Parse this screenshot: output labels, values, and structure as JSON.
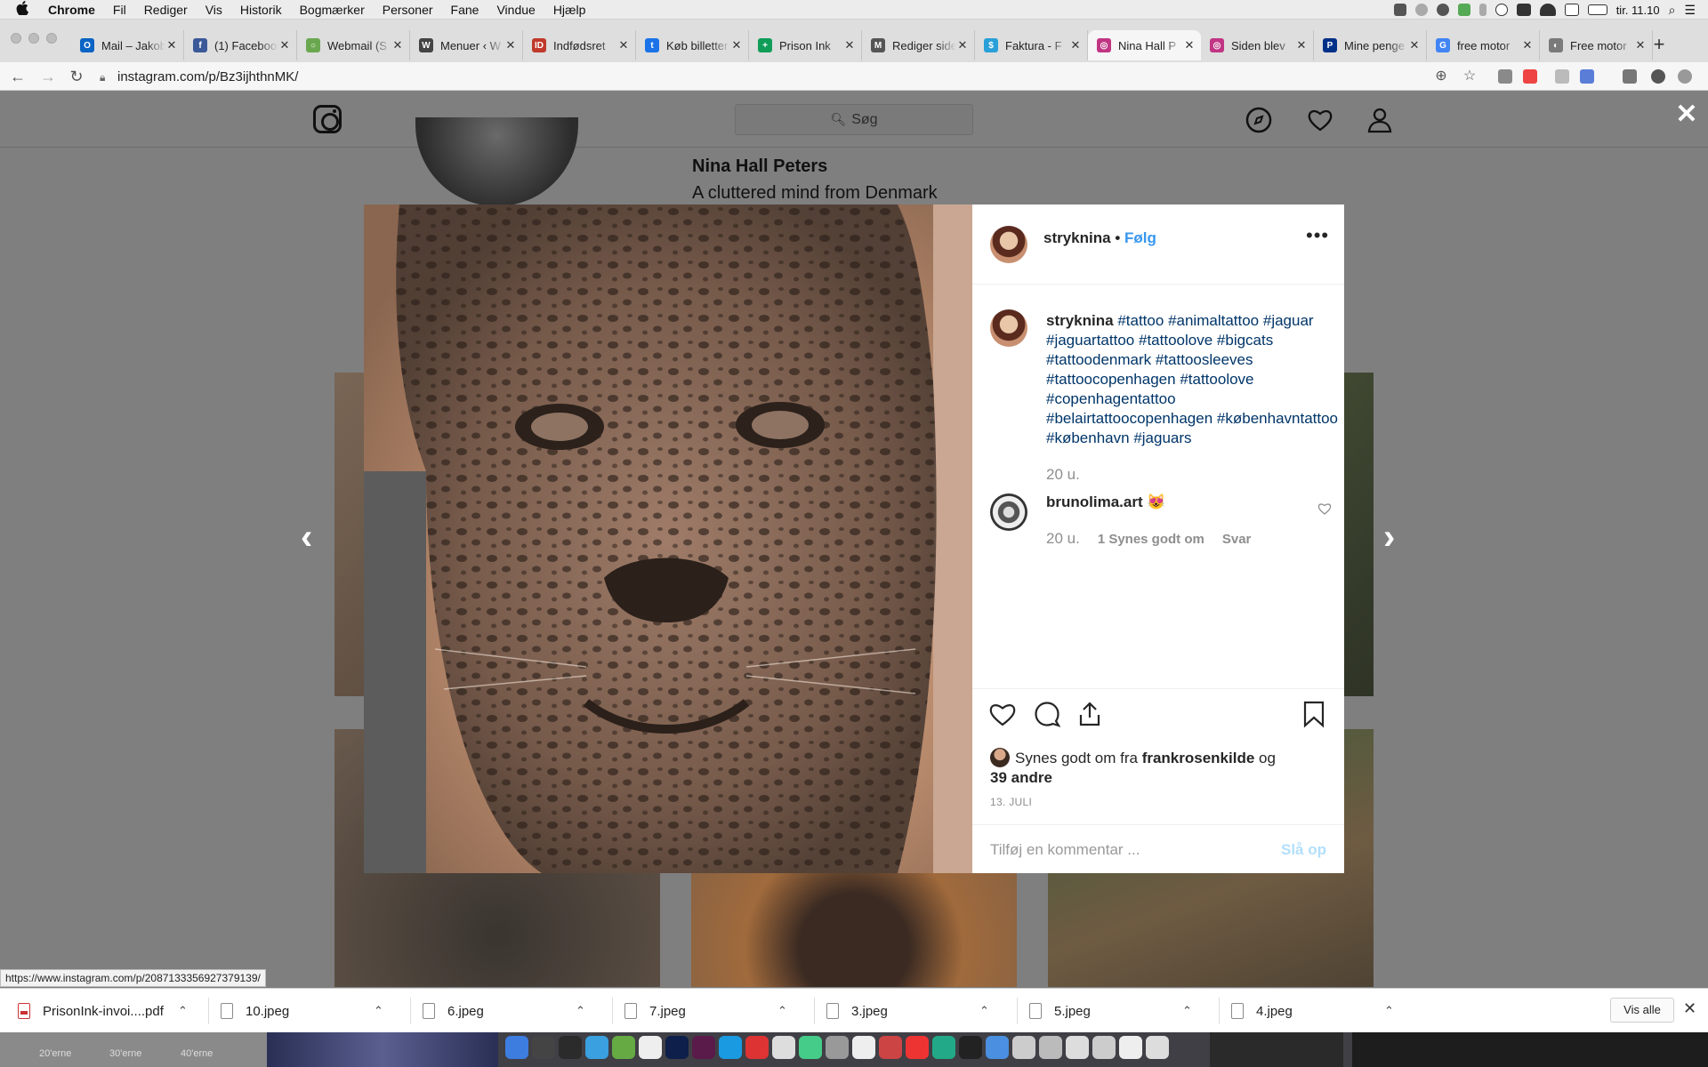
{
  "menubar": {
    "apple": "",
    "items": [
      "Chrome",
      "Fil",
      "Rediger",
      "Vis",
      "Historik",
      "Bogmærker",
      "Personer",
      "Fane",
      "Vindue",
      "Hjælp"
    ],
    "clock": "tir. 11.10"
  },
  "browser": {
    "tabs": [
      {
        "label": "Mail – Jakob",
        "icon": "outlook-icon",
        "color": "#0a64c4",
        "glyph": "O"
      },
      {
        "label": "(1) Facebook",
        "icon": "facebook-icon",
        "color": "#3b5998",
        "glyph": "f"
      },
      {
        "label": "Webmail (S",
        "icon": "webmail-icon",
        "color": "#6aa84f",
        "glyph": "○"
      },
      {
        "label": "Menuer ‹ W",
        "icon": "wordpress-icon",
        "color": "#444",
        "glyph": "W"
      },
      {
        "label": "Indfødsret",
        "icon": "indfodsret-icon",
        "color": "#c0392b",
        "glyph": "ID"
      },
      {
        "label": "Køb billetter",
        "icon": "tickets-icon",
        "color": "#1a73e8",
        "glyph": "t"
      },
      {
        "label": "Prison Ink",
        "icon": "sheets-icon",
        "color": "#0f9d58",
        "glyph": "+"
      },
      {
        "label": "Rediger side",
        "icon": "edit-page-icon",
        "color": "#555",
        "glyph": "M"
      },
      {
        "label": "Faktura - F",
        "icon": "invoice-icon",
        "color": "#2aa0d8",
        "glyph": "$"
      },
      {
        "label": "Nina Hall P",
        "icon": "instagram-icon",
        "color": "#c13584",
        "glyph": "◎",
        "active": true
      },
      {
        "label": "Siden blev",
        "icon": "instagram-icon",
        "color": "#c13584",
        "glyph": "◎"
      },
      {
        "label": "Mine penge",
        "icon": "paypal-icon",
        "color": "#003087",
        "glyph": "P"
      },
      {
        "label": "free motor",
        "icon": "google-icon",
        "color": "#4285f4",
        "glyph": "G"
      },
      {
        "label": "Free motor",
        "icon": "site-icon",
        "color": "#7a7a7a",
        "glyph": "◐"
      }
    ],
    "url": "instagram.com/p/Bz3ijhthnMK/",
    "status_url": "https://www.instagram.com/p/2087133356927379139/"
  },
  "instagram": {
    "search_placeholder": "Søg",
    "profile": {
      "name": "Nina Hall Peters",
      "bio": "A cluttered mind from Denmark"
    },
    "post": {
      "username": "stryknina",
      "dot": " • ",
      "follow": "Følg",
      "caption_user": "stryknina",
      "hashtags": [
        "#tattoo",
        "#animaltattoo",
        "#jaguar",
        "#jaguartattoo",
        "#tattoolove",
        "#bigcats",
        "#tattoodenmark",
        "#tattoosleeves",
        "#tattoocopenhagen",
        "#tattoolove",
        "#copenhagentattoo",
        "#belairtattoocopenhagen",
        "#københavntattoo",
        "#københavn",
        "#jaguars"
      ],
      "caption_time": "20 u.",
      "comment": {
        "user": "brunolima.art",
        "text": "😻",
        "time": "20 u.",
        "likes": "1 Synes godt om",
        "reply": "Svar"
      },
      "likes_prefix": "Synes godt om fra ",
      "likes_user": "frankrosenkilde",
      "likes_and": " og",
      "likes_others": "39 andre",
      "date": "13. JULI",
      "comment_placeholder": "Tilføj en kommentar ...",
      "post_button": "Slå op"
    }
  },
  "downloads": {
    "items": [
      "PrisonInk-invoi....pdf",
      "10.jpeg",
      "6.jpeg",
      "7.jpeg",
      "3.jpeg",
      "5.jpeg",
      "4.jpeg"
    ],
    "show_all": "Vis alle"
  },
  "dock": {
    "decades": [
      "20'erne",
      "30'erne",
      "40'erne"
    ]
  }
}
